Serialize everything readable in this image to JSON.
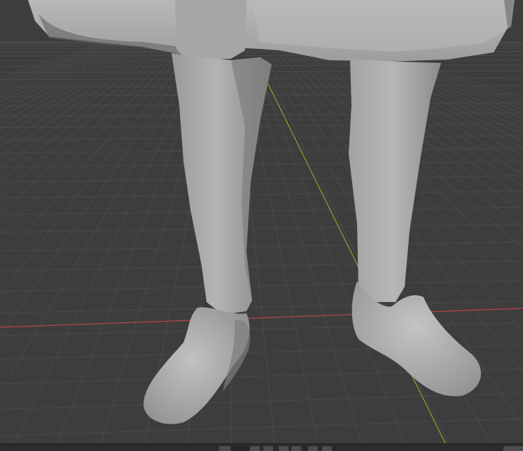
{
  "app": {
    "viewport_bg": "#3d3d3d",
    "grid_color": "#4a4a4a",
    "x_axis_color": "#c0474f",
    "y_axis_color": "#7aaa2f",
    "model_color": "#a9a9a9"
  },
  "viewport": {
    "object": "sculpted-character-lower-body"
  },
  "statusbar": {
    "controls": [
      {
        "icon": "mode-icon"
      },
      {
        "icon": "active-slot"
      },
      {
        "icon": "arrow-icon"
      },
      {
        "icon": "arrow-icon"
      },
      {
        "icon": "arrow-icon"
      },
      {
        "icon": "arrow-icon"
      },
      {
        "icon": "arrow-icon"
      },
      {
        "icon": "arrow-icon"
      }
    ]
  }
}
